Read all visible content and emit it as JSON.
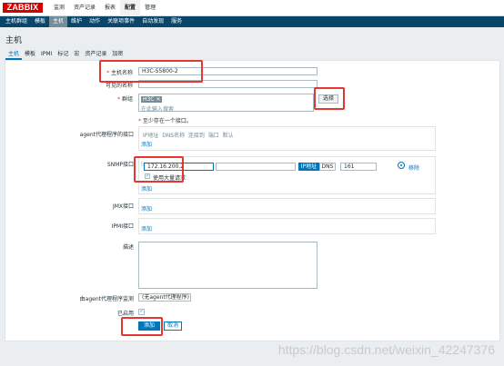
{
  "app": {
    "logo": "ZABBIX"
  },
  "top_menu": [
    {
      "label": "监测",
      "active": false
    },
    {
      "label": "资产记录",
      "active": false
    },
    {
      "label": "报表",
      "active": false
    },
    {
      "label": "配置",
      "active": true
    },
    {
      "label": "管理",
      "active": false
    }
  ],
  "sub_menu": [
    {
      "label": "主机群组",
      "active": false
    },
    {
      "label": "模板",
      "active": false
    },
    {
      "label": "主机",
      "active": true
    },
    {
      "label": "维护",
      "active": false
    },
    {
      "label": "动作",
      "active": false
    },
    {
      "label": "关联项事件",
      "active": false
    },
    {
      "label": "自动发现",
      "active": false
    },
    {
      "label": "服务",
      "active": false
    }
  ],
  "page_title": "主机",
  "tabs": [
    {
      "label": "主机",
      "active": true
    },
    {
      "label": "模板",
      "active": false
    },
    {
      "label": "IPMI",
      "active": false
    },
    {
      "label": "标记",
      "active": false
    },
    {
      "label": "宏",
      "active": false
    },
    {
      "label": "资产记录",
      "active": false
    },
    {
      "label": "加密",
      "active": false
    }
  ],
  "form": {
    "hostname_label": "主机名称",
    "hostname_value": "H3C-S5800-2",
    "visible_name_label": "可见的名称",
    "groups_label": "群组",
    "group_tag": "H3C",
    "group_remove": "✕",
    "groups_placeholder": "在此输入搜索",
    "select_button": "选择",
    "interface_note": "至少存在一个接口。",
    "agent_label": "agent代理程序的接口",
    "interface_header": "IP地址  DNS名称  连接到  端口  默认",
    "add_link": "添加",
    "snmp_label": "SNMP接口",
    "snmp_ip": "172.16.200.2",
    "snmp_conn_ip": "IP地址",
    "snmp_conn_dns": "DNS",
    "snmp_port": "161",
    "snmp_remove": "移除",
    "bulk_label": "使用大量请求",
    "jmx_label": "JMX接口",
    "ipmi_label": "IPMI接口",
    "desc_label": "描述",
    "proxy_label": "由agent代理程序监测",
    "proxy_value": "(无agent代理程序)",
    "enabled_label": "已启用",
    "add_button": "添加",
    "cancel_button": "取消"
  },
  "watermark": "https://blog.csdn.net/weixin_42247376",
  "colors": {
    "brand": "#d40000",
    "nav": "#0a466a",
    "accent": "#0275b8",
    "highlight": "#e33734"
  }
}
